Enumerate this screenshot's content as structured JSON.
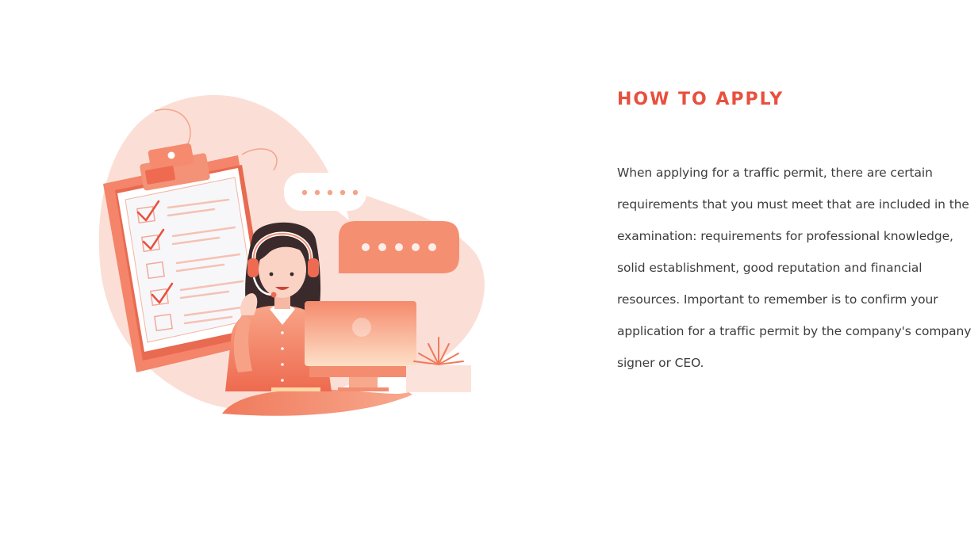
{
  "section": {
    "title": "HOW TO APPLY",
    "paragraph": "When applying for a traffic permit, there are certain requirements that you must meet that are included in the examination: requirements for professional knowledge, solid establishment, good reputation and financial resources. Important to remember is to confirm your application for a traffic permit by the company's company signer or CEO."
  },
  "colors": {
    "accent": "#e8503e",
    "body_text": "#3d3d3d",
    "illustration_peach": "#fadcd3",
    "illustration_orange": "#f4906f"
  },
  "illustration": {
    "icons": [
      "clipboard-checklist-icon",
      "support-agent-headset-icon",
      "chat-bubble-icon",
      "computer-monitor-icon",
      "plant-icon"
    ]
  }
}
